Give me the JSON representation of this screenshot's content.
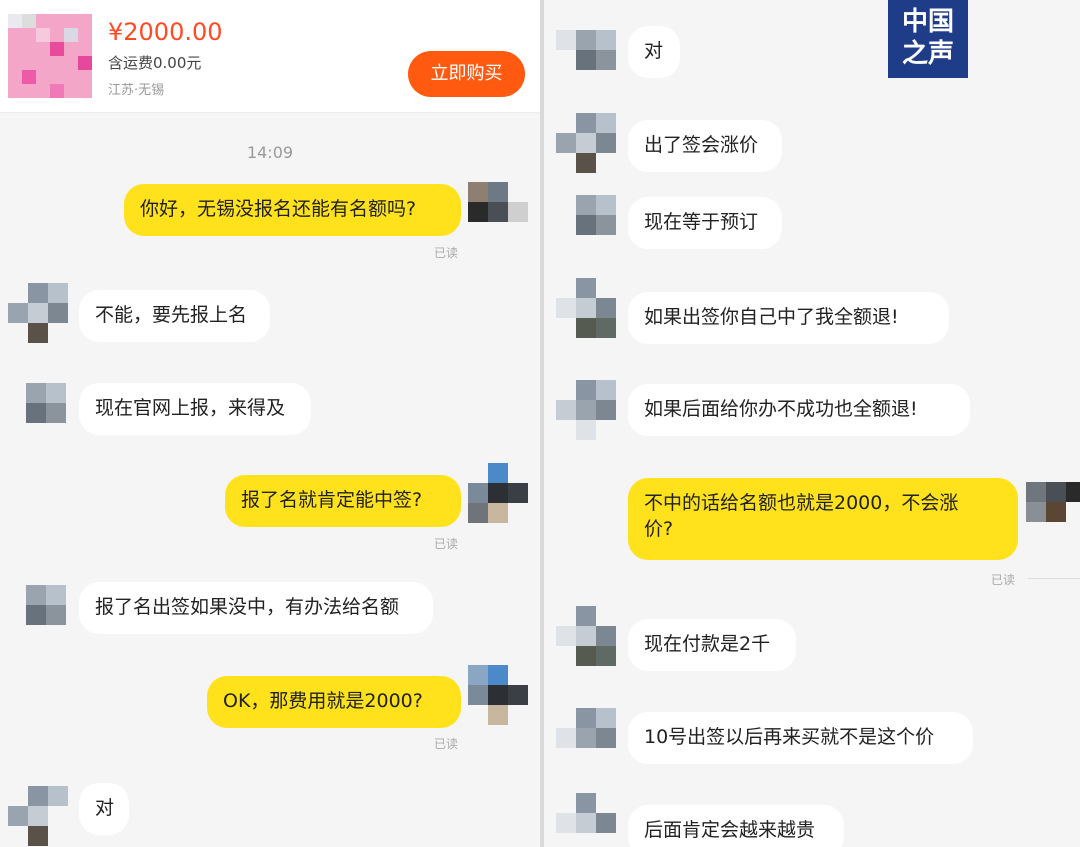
{
  "product": {
    "price": "¥2000.00",
    "shipping": "含运费0.00元",
    "location": "江苏·无锡",
    "buy_label": "立即购买"
  },
  "timestamp": "14:09",
  "read_label": "已读",
  "watermark": "中国之声",
  "left_messages": [
    "你好，无锡没报名还能有名额吗?",
    "不能，要先报上名",
    "现在官网上报，来得及",
    "报了名就肯定能中签?",
    "报了名出签如果没中，有办法给名额",
    "OK，那费用就是2000?",
    "对"
  ],
  "right_messages": [
    "对",
    "出了签会涨价",
    "现在等于预订",
    "如果出签你自己中了我全额退!",
    "如果后面给你办不成功也全额退!",
    "不中的话给名额也就是2000，不会涨",
    "价?",
    "现在付款是2千",
    "10号出签以后再来买就不是这个价",
    "后面肯定会越来越贵"
  ],
  "colors": {
    "outgoing_bubble": "#ffe21c",
    "incoming_bubble": "#ffffff",
    "price": "#ff4a22",
    "buy_button": "#ff5a10",
    "background": "#f5f5f5"
  }
}
